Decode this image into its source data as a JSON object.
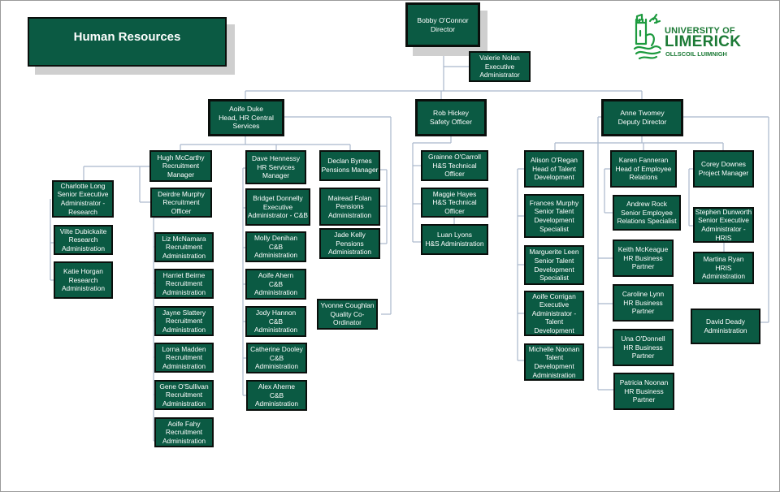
{
  "page": {
    "title": "Human Resources"
  },
  "logo": {
    "line1": "UNIVERSITY OF",
    "line2": "LIMERICK",
    "line3": "OLLSCOIL LUIMNIGH",
    "color": "#1c7a36"
  },
  "colors": {
    "box_fill": "#0b5a43",
    "box_border": "#0a0f0c",
    "connector": "#a9b8cc",
    "text": "#ffffff"
  },
  "nodes": {
    "director": "Bobby O'Connor\nDirector",
    "exec_admin": "Valerie Nolan\nExecutive\nAdministrator",
    "aoife_duke": "Aoife Duke\nHead, HR Central\nServices",
    "rob_hickey": "Rob Hickey\nSafety Officer",
    "anne_twomey": "Anne Twomey\nDeputy Director",
    "hugh_mccarthy": "Hugh McCarthy\nRecruitment\nManager",
    "deirdre_murphy": "Deirdre Murphy\nRecruitment\nOfficer",
    "charlotte_long": "Charlotte Long\nSenior Executive\nAdministrator -\nResearch",
    "vilte_dubickaite": "Vilte Dubickaite\nResearch\nAdministration",
    "katie_horgan": "Katie Horgan\nResearch\nAdministration",
    "liz_mcnamara": "Liz McNamara\nRecruitment\nAdministration",
    "harriet_beirne": "Harriet Beirne\nRecruitment\nAdministration",
    "jayne_slattery": "Jayne Slattery\nRecruitment\nAdministration",
    "lorna_madden": "Lorna Madden\nRecruitment\nAdministration",
    "gene_osullivan": "Gene O'Sullivan\nRecruitment\nAdministration",
    "aoife_fahy": "Aoife Fahy\nRecruitment\nAdministration",
    "dave_hennessy": "Dave Hennessy\nHR Services\nManager",
    "bridget_donnelly": "Bridget Donnelly\nExecutive\nAdministrator - C&B",
    "molly_denihan": "Molly Denihan\nC&B\nAdministration",
    "aoife_ahern": "Aoife Ahern\nC&B\nAdministration",
    "jody_hannon": "Jody Hannon\nC&B\nAdministration",
    "catherine_dooley": "Catherine Dooley\nC&B\nAdministration",
    "alex_aherne": "Alex Aherne\nC&B\nAdministration",
    "declan_byrnes": "Declan Byrnes\nPensions Manager",
    "mairead_folan": "Mairead Folan\nPensions\nAdministration",
    "jade_kelly": "Jade Kelly\nPensions\nAdministration",
    "yvonne_coughlan": "Yvonne Coughlan\nQuality Co-\nOrdinator",
    "grainne_ocarroll": "Grainne O'Carroll\nH&S Technical\nOfficer",
    "maggie_hayes": "Maggie Hayes\nH&S Technical\nOfficer",
    "luan_lyons": "Luan Lyons\nH&S Administration",
    "alison_oregan": "Alison O'Regan\nHead of Talent\nDevelopment",
    "frances_murphy": "Frances Murphy\nSenior Talent\nDevelopment\nSpecialist",
    "marguerite_leen": "Marguerite Leen\nSenior Talent\nDevelopment\nSpecialist",
    "aoife_corrigan": "Aoife Corrigan\nExecutive\nAdministrator -\nTalent\nDevelopment",
    "michelle_noonan": "Michelle Noonan\nTalent\nDevelopment\nAdministration",
    "karen_fanneran": "Karen Fanneran\nHead of Employee\nRelations",
    "andrew_rock": "Andrew Rock\nSenior Employee\nRelations Specialist",
    "keith_mckeague": "Keith McKeague\nHR Business\nPartner",
    "caroline_lynn": "Caroline Lynn\nHR Business\nPartner",
    "una_odonnell": "Una O'Donnell\nHR Business\nPartner",
    "patricia_noonan": "Patricia Noonan\nHR Business\nPartner",
    "corey_downes": "Corey Downes\nProject Manager",
    "stephen_dunworth": "Stephen Dunworth\nSenior Executive\nAdministrator -\nHRIS",
    "martina_ryan": "Martina Ryan\nHRIS\nAdministration",
    "david_deady": "David Deady\nAdministration"
  }
}
